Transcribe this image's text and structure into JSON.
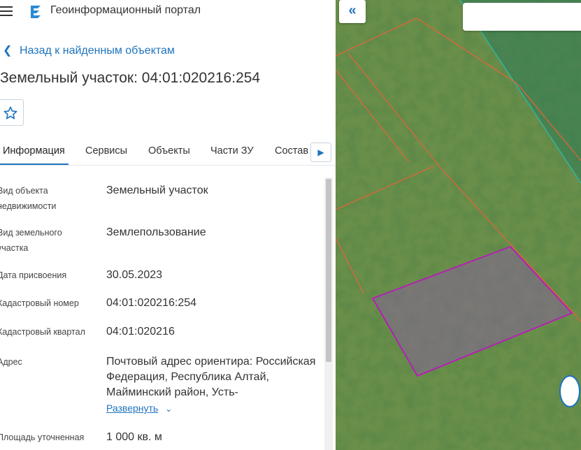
{
  "app": {
    "title": "Геоинформационный портал"
  },
  "nav": {
    "back_label": "Назад к найденным объектам"
  },
  "object": {
    "title": "Земельный участок: 04:01:020216:254"
  },
  "tabs": [
    {
      "label": "Информация"
    },
    {
      "label": "Сервисы"
    },
    {
      "label": "Объекты"
    },
    {
      "label": "Части ЗУ"
    },
    {
      "label": "Состав"
    }
  ],
  "details": [
    {
      "label": "Вид объекта недвижимости",
      "value": "Земельный участок"
    },
    {
      "label": "Вид земельного участка",
      "value": "Землепользование"
    },
    {
      "label": "Дата присвоения",
      "value": "30.05.2023"
    },
    {
      "label": "Кадастровый номер",
      "value": "04:01:020216:254"
    },
    {
      "label": "Кадастровый квартал",
      "value": "04:01:020216"
    },
    {
      "label": "Адрес",
      "value": "Почтовый адрес ориентира: Российская Федерация, Республика Алтай, Майминский район, Усть-"
    },
    {
      "label": "Площадь уточненная",
      "value": "1 000 кв. м"
    }
  ],
  "expand_label": "Развернуть",
  "colors": {
    "accent": "#1e73be",
    "parcel_selected": "#b51fb5",
    "parcel_border": "#e0653a",
    "zone_border": "#2fb5a0"
  },
  "icons": [
    "menu-icon",
    "portal-logo-icon",
    "chevron-left-icon",
    "star-icon",
    "chevron-right-icon",
    "chevron-down-icon",
    "double-chevron-left-icon"
  ]
}
